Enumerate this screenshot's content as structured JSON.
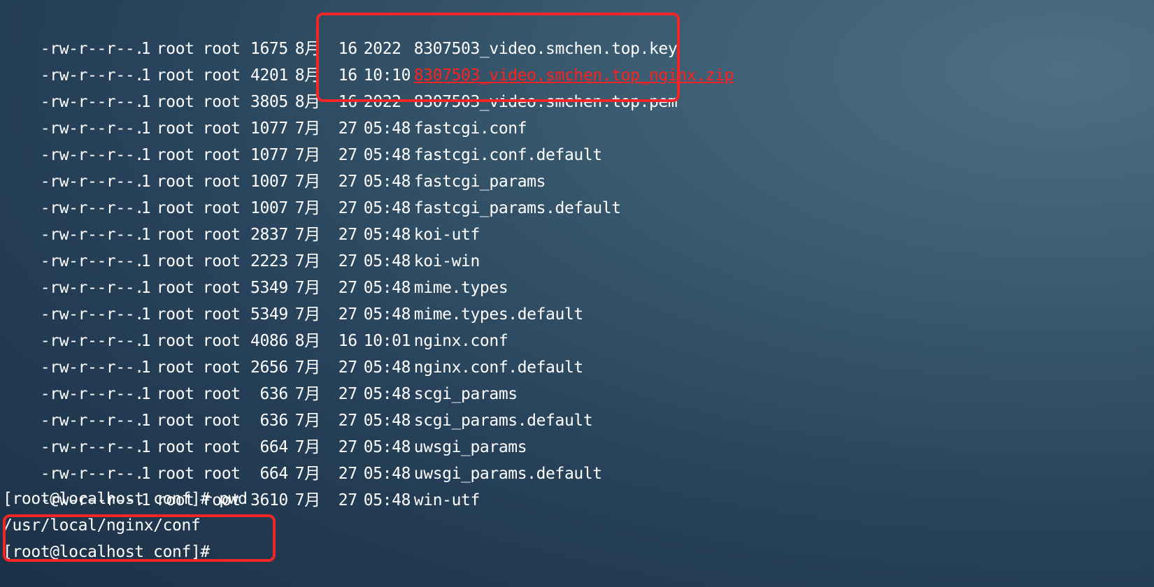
{
  "listing": [
    {
      "perm": "-rw-r--r--.",
      "links": "1",
      "user": "root",
      "group": "root",
      "size": "1675",
      "month": "8月",
      "day": "16",
      "time": "2022",
      "name": "8307503_video.smchen.top.key",
      "highlight": false
    },
    {
      "perm": "-rw-r--r--.",
      "links": "1",
      "user": "root",
      "group": "root",
      "size": "4201",
      "month": "8月",
      "day": "16",
      "time": "10:10",
      "name": "8307503_video.smchen.top_nginx.zip",
      "highlight": true
    },
    {
      "perm": "-rw-r--r--.",
      "links": "1",
      "user": "root",
      "group": "root",
      "size": "3805",
      "month": "8月",
      "day": "16",
      "time": "2022",
      "name": "8307503_video.smchen.top.pem",
      "highlight": false
    },
    {
      "perm": "-rw-r--r--.",
      "links": "1",
      "user": "root",
      "group": "root",
      "size": "1077",
      "month": "7月",
      "day": "27",
      "time": "05:48",
      "name": "fastcgi.conf",
      "highlight": false
    },
    {
      "perm": "-rw-r--r--.",
      "links": "1",
      "user": "root",
      "group": "root",
      "size": "1077",
      "month": "7月",
      "day": "27",
      "time": "05:48",
      "name": "fastcgi.conf.default",
      "highlight": false
    },
    {
      "perm": "-rw-r--r--.",
      "links": "1",
      "user": "root",
      "group": "root",
      "size": "1007",
      "month": "7月",
      "day": "27",
      "time": "05:48",
      "name": "fastcgi_params",
      "highlight": false
    },
    {
      "perm": "-rw-r--r--.",
      "links": "1",
      "user": "root",
      "group": "root",
      "size": "1007",
      "month": "7月",
      "day": "27",
      "time": "05:48",
      "name": "fastcgi_params.default",
      "highlight": false
    },
    {
      "perm": "-rw-r--r--.",
      "links": "1",
      "user": "root",
      "group": "root",
      "size": "2837",
      "month": "7月",
      "day": "27",
      "time": "05:48",
      "name": "koi-utf",
      "highlight": false
    },
    {
      "perm": "-rw-r--r--.",
      "links": "1",
      "user": "root",
      "group": "root",
      "size": "2223",
      "month": "7月",
      "day": "27",
      "time": "05:48",
      "name": "koi-win",
      "highlight": false
    },
    {
      "perm": "-rw-r--r--.",
      "links": "1",
      "user": "root",
      "group": "root",
      "size": "5349",
      "month": "7月",
      "day": "27",
      "time": "05:48",
      "name": "mime.types",
      "highlight": false
    },
    {
      "perm": "-rw-r--r--.",
      "links": "1",
      "user": "root",
      "group": "root",
      "size": "5349",
      "month": "7月",
      "day": "27",
      "time": "05:48",
      "name": "mime.types.default",
      "highlight": false
    },
    {
      "perm": "-rw-r--r--.",
      "links": "1",
      "user": "root",
      "group": "root",
      "size": "4086",
      "month": "8月",
      "day": "16",
      "time": "10:01",
      "name": "nginx.conf",
      "highlight": false
    },
    {
      "perm": "-rw-r--r--.",
      "links": "1",
      "user": "root",
      "group": "root",
      "size": "2656",
      "month": "7月",
      "day": "27",
      "time": "05:48",
      "name": "nginx.conf.default",
      "highlight": false
    },
    {
      "perm": "-rw-r--r--.",
      "links": "1",
      "user": "root",
      "group": "root",
      "size": "636",
      "month": "7月",
      "day": "27",
      "time": "05:48",
      "name": "scgi_params",
      "highlight": false
    },
    {
      "perm": "-rw-r--r--.",
      "links": "1",
      "user": "root",
      "group": "root",
      "size": "636",
      "month": "7月",
      "day": "27",
      "time": "05:48",
      "name": "scgi_params.default",
      "highlight": false
    },
    {
      "perm": "-rw-r--r--.",
      "links": "1",
      "user": "root",
      "group": "root",
      "size": "664",
      "month": "7月",
      "day": "27",
      "time": "05:48",
      "name": "uwsgi_params",
      "highlight": false
    },
    {
      "perm": "-rw-r--r--.",
      "links": "1",
      "user": "root",
      "group": "root",
      "size": "664",
      "month": "7月",
      "day": "27",
      "time": "05:48",
      "name": "uwsgi_params.default",
      "highlight": false
    },
    {
      "perm": "-rw-r--r--.",
      "links": "1",
      "user": "root",
      "group": "root",
      "size": "3610",
      "month": "7月",
      "day": "27",
      "time": "05:48",
      "name": "win-utf",
      "highlight": false
    }
  ],
  "shell": {
    "prompt_cmd": "[root@localhost conf]# pwd",
    "pwd_output": "/usr/local/nginx/conf",
    "prompt_final": "[root@localhost conf]#"
  },
  "colors": {
    "text": "#ffffff",
    "highlight_text": "#ff2020",
    "annotation_border": "#f22626",
    "background": "#2c4a62"
  }
}
